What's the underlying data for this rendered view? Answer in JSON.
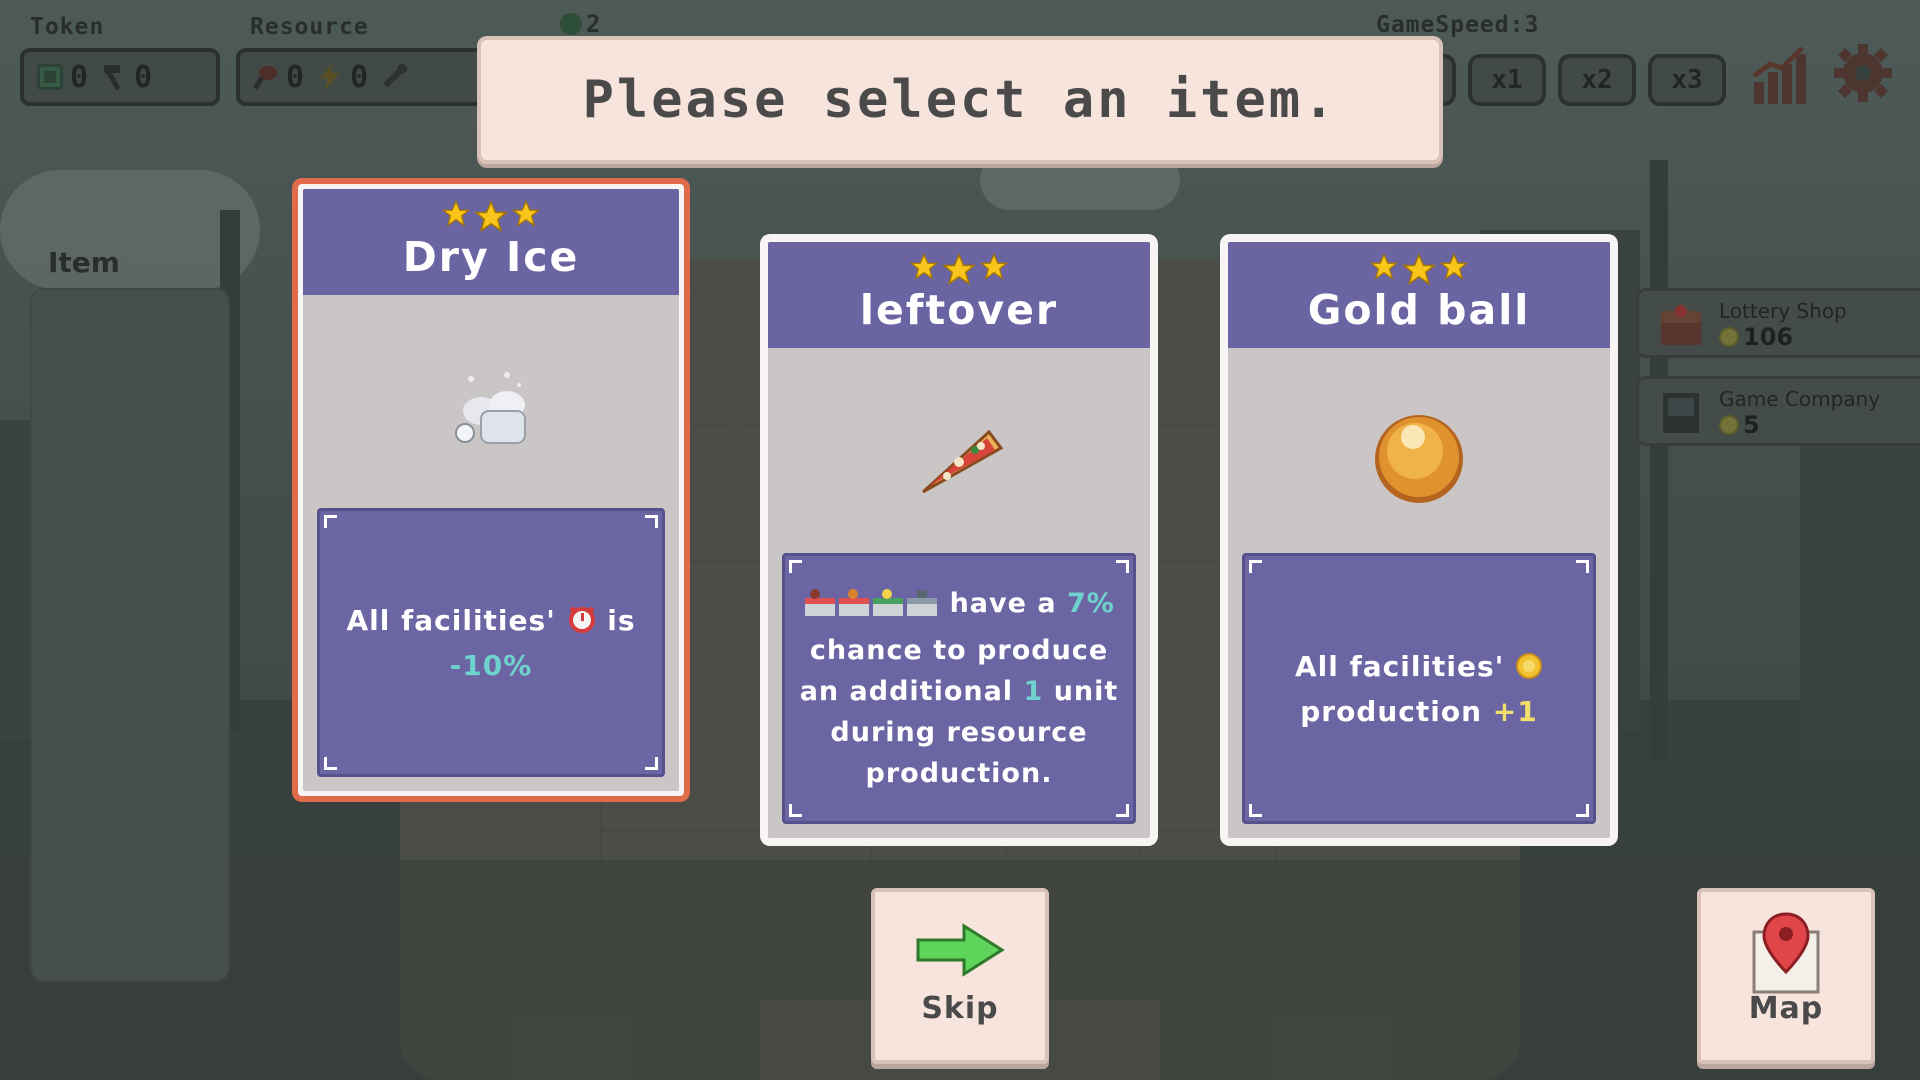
{
  "hud": {
    "token_label": "Token",
    "resource_label": "Resource",
    "game_speed_label": "GameSpeed:",
    "game_speed_value": "3",
    "tokens": [
      {
        "icon": "recycle-icon",
        "value": "0"
      },
      {
        "icon": "hammer-icon",
        "value": "0"
      }
    ],
    "resources": [
      {
        "icon": "meat-icon",
        "value": "0"
      },
      {
        "icon": "lightning-icon",
        "value": "0"
      },
      {
        "icon": "wrench-icon",
        "value": "0"
      }
    ],
    "speed_buttons": [
      "x1",
      "x2",
      "x3"
    ],
    "mini_counter": "2"
  },
  "left_panel": {
    "title": "Item"
  },
  "shops": [
    {
      "name": "Lottery Shop",
      "count": "106",
      "icon": "treasure-chest-icon"
    },
    {
      "name": "Game Company",
      "count": "5",
      "icon": "arcade-machine-icon"
    }
  ],
  "banner": {
    "text": "Please select an item."
  },
  "cards": [
    {
      "name": "Dry Ice",
      "stars": 3,
      "icon": "dry-ice-icon",
      "selected": true,
      "desc_pre": "All facilities'",
      "desc_mid": "is",
      "desc_value": "-10%",
      "desc_icon": "alarm-clock-icon"
    },
    {
      "name": "leftover",
      "stars": 3,
      "icon": "pizza-slice-icon",
      "selected": false,
      "desc_mid": "have a",
      "desc_pct": "7%",
      "desc_line2": "chance to produce",
      "desc_line3a": "an additional",
      "desc_unit": "1",
      "desc_line3b": "unit",
      "desc_line4": "during resource",
      "desc_line5": "production.",
      "desc_icons": [
        "food-stall-icon",
        "chicken-stall-icon",
        "banana-stall-icon",
        "tool-stall-icon"
      ]
    },
    {
      "name": "Gold ball",
      "stars": 3,
      "icon": "gold-ball-icon",
      "selected": false,
      "desc_pre": "All facilities'",
      "desc_line2": "production",
      "desc_value": "+1",
      "desc_icon": "coin-icon"
    }
  ],
  "buttons": {
    "skip_label": "Skip",
    "map_label": "Map"
  },
  "colors": {
    "card_header": "#6a64a2",
    "card_desc_bg": "#6b66a3",
    "selected_border": "#e06a4a",
    "banner_bg": "#f6e4dd",
    "teal_highlight": "#6fd2cc",
    "yellow_highlight": "#f3e06a"
  }
}
